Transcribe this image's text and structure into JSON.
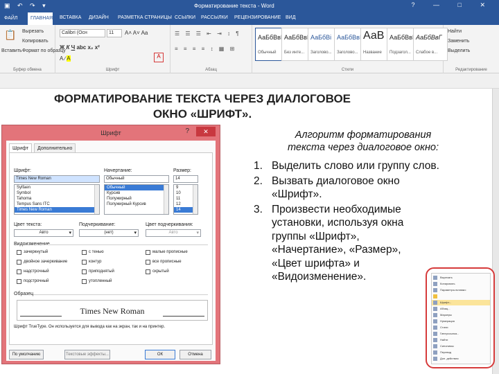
{
  "window": {
    "title": "Форматирование текста - Word",
    "controls": [
      "?",
      "—",
      "□",
      "✕"
    ]
  },
  "ribbon_tabs": [
    "ФАЙЛ",
    "ГЛАВНАЯ",
    "ВСТАВКА",
    "ДИЗАЙН",
    "РАЗМЕТКА СТРАНИЦЫ",
    "ССЫЛКИ",
    "РАССЫЛКИ",
    "РЕЦЕНЗИРОВАНИЕ",
    "ВИД"
  ],
  "ribbon": {
    "paste_label": "Вставить",
    "clipboard": {
      "cut": "Вырезать",
      "copy": "Копировать",
      "format_painter": "Формат по образцу",
      "group_label": "Буфер обмена"
    },
    "font": {
      "name": "Calibri (Осн",
      "size": "11",
      "group_label": "Шрифт"
    },
    "paragraph": {
      "group_label": "Абзац"
    },
    "styles": {
      "items": [
        {
          "sample": "АаБбВвГ",
          "name": "Обычный"
        },
        {
          "sample": "АаБбВвГ",
          "name": "Без инте..."
        },
        {
          "sample": "АаБбВі",
          "name": "Заголово..."
        },
        {
          "sample": "АаБбВвІ",
          "name": "Заголово..."
        },
        {
          "sample": "АаВ",
          "name": "Название"
        },
        {
          "sample": "АаБбВвГ",
          "name": "Подзагол..."
        },
        {
          "sample": "АаБбВвГ",
          "name": "Слабое в..."
        }
      ],
      "group_label": "Стили"
    },
    "editing": {
      "find": "Найти",
      "replace": "Заменить",
      "select": "Выделить",
      "group_label": "Редактирование"
    }
  },
  "heading": {
    "line1": "ФОРМАТИРОВАНИЕ ТЕКСТА ЧЕРЕЗ ДИАЛОГОВОЕ",
    "line2": "ОКНО «ШРИФТ»."
  },
  "dialog": {
    "title": "Шрифт",
    "help": "?",
    "close": "✕",
    "tabs": [
      "Шрифт",
      "Дополнительно"
    ],
    "font_label": "Шрифт:",
    "style_label": "Начертание:",
    "size_label": "Размер:",
    "font_value": "Times New Roman",
    "style_value": "Обычный",
    "size_value": "14",
    "font_list": [
      "Sylfaen",
      "Symbol",
      "Tahoma",
      "Tempus Sans ITC",
      "Times New Roman"
    ],
    "style_list": [
      "Обычный",
      "Курсив",
      "Полужирный",
      "Полужирный Курсив"
    ],
    "size_list": [
      "9",
      "10",
      "11",
      "12",
      "14"
    ],
    "color_label": "Цвет текста:",
    "color_value": "Авто",
    "underline_label": "Подчеркивание:",
    "underline_value": "(нет)",
    "underline_color_label": "Цвет подчеркивания:",
    "underline_color_value": "Авто",
    "effects_label": "Видоизменение",
    "effects": [
      "зачеркнутый",
      "с тенью",
      "малые прописные",
      "двойное зачеркивание",
      "контур",
      "все прописные",
      "надстрочный",
      "приподнятый",
      "скрытый",
      "подстрочный",
      "утопленный"
    ],
    "preview_label": "Образец",
    "preview_text": "Times New Roman",
    "preview_note": "Шрифт TrueType. Он используется для вывода как на экран, так и на принтер.",
    "buttons": [
      "По умолчанию",
      "Текстовые эффекты...",
      "ОК",
      "Отмена"
    ]
  },
  "algorithm": {
    "title_line1": "Алгоритм форматирования",
    "title_line2": "текста через диалоговое окно:",
    "steps": [
      {
        "num": "1.",
        "text": "Выделить слово или группу слов."
      },
      {
        "num": "2.",
        "text": "Вызвать диалоговое окно «Шрифт»."
      },
      {
        "num": "3.",
        "text": "Произвести необходимые установки, используя окна группы «Шрифт», «Начертание», «Размер», «Цвет шрифта» и «Видоизменение»."
      }
    ]
  },
  "context_menu": {
    "items": [
      "Вырезать",
      "Копировать",
      "Параметры вставки:",
      "",
      "Шрифт...",
      "Абзац...",
      "Маркеры",
      "Нумерация",
      "Стили",
      "Гиперссылка...",
      "Найти",
      "Синонимы",
      "Перевод",
      "Доп. действия"
    ],
    "highlighted_index": 4
  }
}
